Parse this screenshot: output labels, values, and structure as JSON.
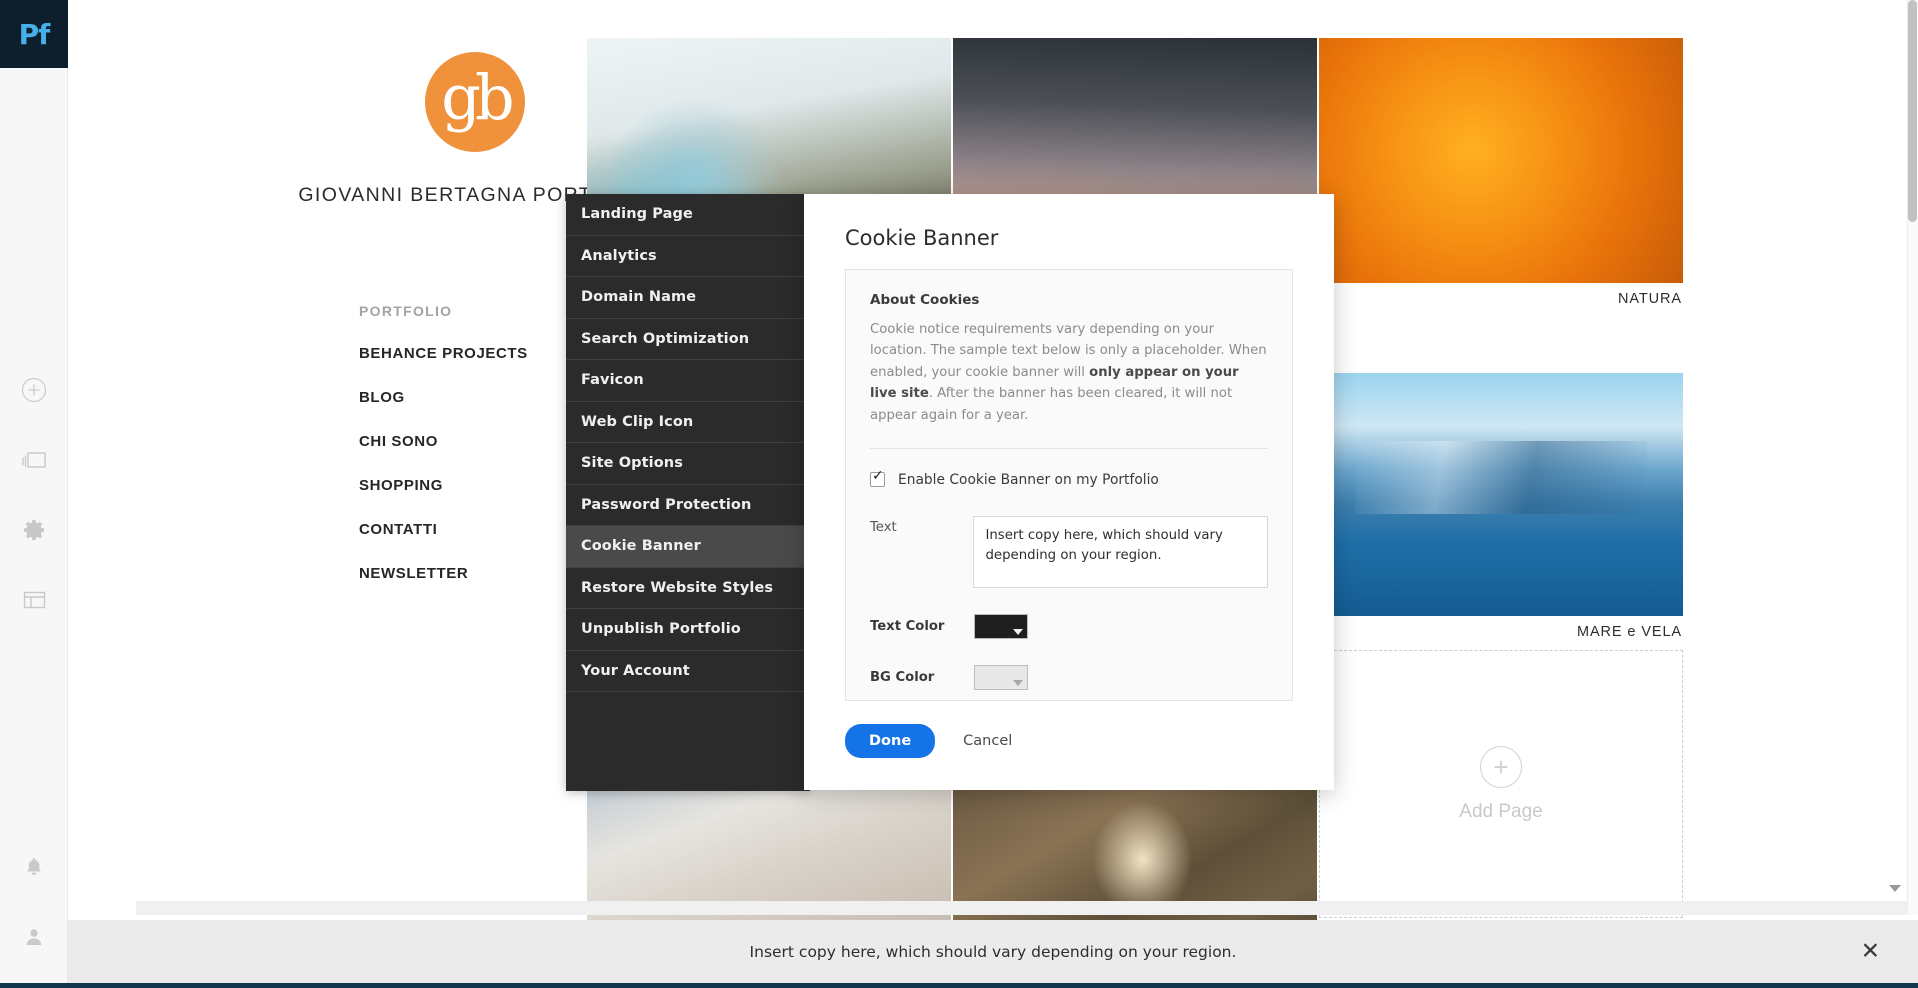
{
  "app": {
    "logo_text": "Pf",
    "rail_icons": [
      "add-icon",
      "pages-icon",
      "gear-icon",
      "layout-icon"
    ],
    "rail_bottom_icons": [
      "bell-icon",
      "account-icon"
    ]
  },
  "site": {
    "brand_mark": "gb",
    "brand_title": "GIOVANNI BERTAGNA PORTFOLIO",
    "nav_heading": "PORTFOLIO",
    "nav_items": [
      {
        "label": "BEHANCE PROJECTS"
      },
      {
        "label": "BLOG"
      },
      {
        "label": "CHI SONO"
      },
      {
        "label": "SHOPPING"
      },
      {
        "label": "CONTATTI"
      },
      {
        "label": "NEWSLETTER"
      }
    ],
    "thumbnails": [
      {
        "name": "frost-window-photo",
        "caption": ""
      },
      {
        "name": "tree-silhouette-photo",
        "caption": ""
      },
      {
        "name": "orange-flower-photo",
        "caption": "NATURA"
      },
      {
        "name": "sailboats-lake-photo",
        "caption": "MARE e VELA"
      },
      {
        "name": "newspaper-hands-photo",
        "caption": ""
      },
      {
        "name": "mushroom-photo",
        "caption": ""
      }
    ],
    "add_page": {
      "label": "Add Page",
      "icon": "plus-icon"
    }
  },
  "settings_menu": {
    "items": [
      {
        "label": "Landing Page",
        "active": false
      },
      {
        "label": "Analytics",
        "active": false
      },
      {
        "label": "Domain Name",
        "active": false
      },
      {
        "label": "Search Optimization",
        "active": false
      },
      {
        "label": "Favicon",
        "active": false
      },
      {
        "label": "Web Clip Icon",
        "active": false
      },
      {
        "label": "Site Options",
        "active": false
      },
      {
        "label": "Password Protection",
        "active": false
      },
      {
        "label": "Cookie Banner",
        "active": true
      },
      {
        "label": "Restore Website Styles",
        "active": false
      },
      {
        "label": "Unpublish Portfolio",
        "active": false
      },
      {
        "label": "Your Account",
        "active": false
      }
    ]
  },
  "dialog": {
    "title": "Cookie Banner",
    "about": {
      "heading": "About Cookies",
      "text_part1": "Cookie notice requirements vary depending on your location. The sample text below is only a placeholder. When enabled, your cookie banner will ",
      "text_bold": "only appear on your live site",
      "text_part2": ". After the banner has been cleared, it will not appear again for a year."
    },
    "enable_checkbox": {
      "label": "Enable Cookie Banner on my Portfolio",
      "checked": true
    },
    "text_field": {
      "label": "Text",
      "value": "Insert copy here, which should vary depending on your region.",
      "placeholder": "Insert copy here, which should vary depending on your region."
    },
    "text_color": {
      "label": "Text Color",
      "value": "#1f1f1f"
    },
    "bg_color": {
      "label": "BG Color",
      "value": "#e8e8e8"
    },
    "done_label": "Done",
    "cancel_label": "Cancel",
    "accent_color": "#1473e6"
  },
  "cookie_banner": {
    "message": "Insert copy here, which should vary depending on your region.",
    "close_icon": "close-icon",
    "bg_color": "#ebebeb",
    "text_color": "#2d2d2d"
  }
}
